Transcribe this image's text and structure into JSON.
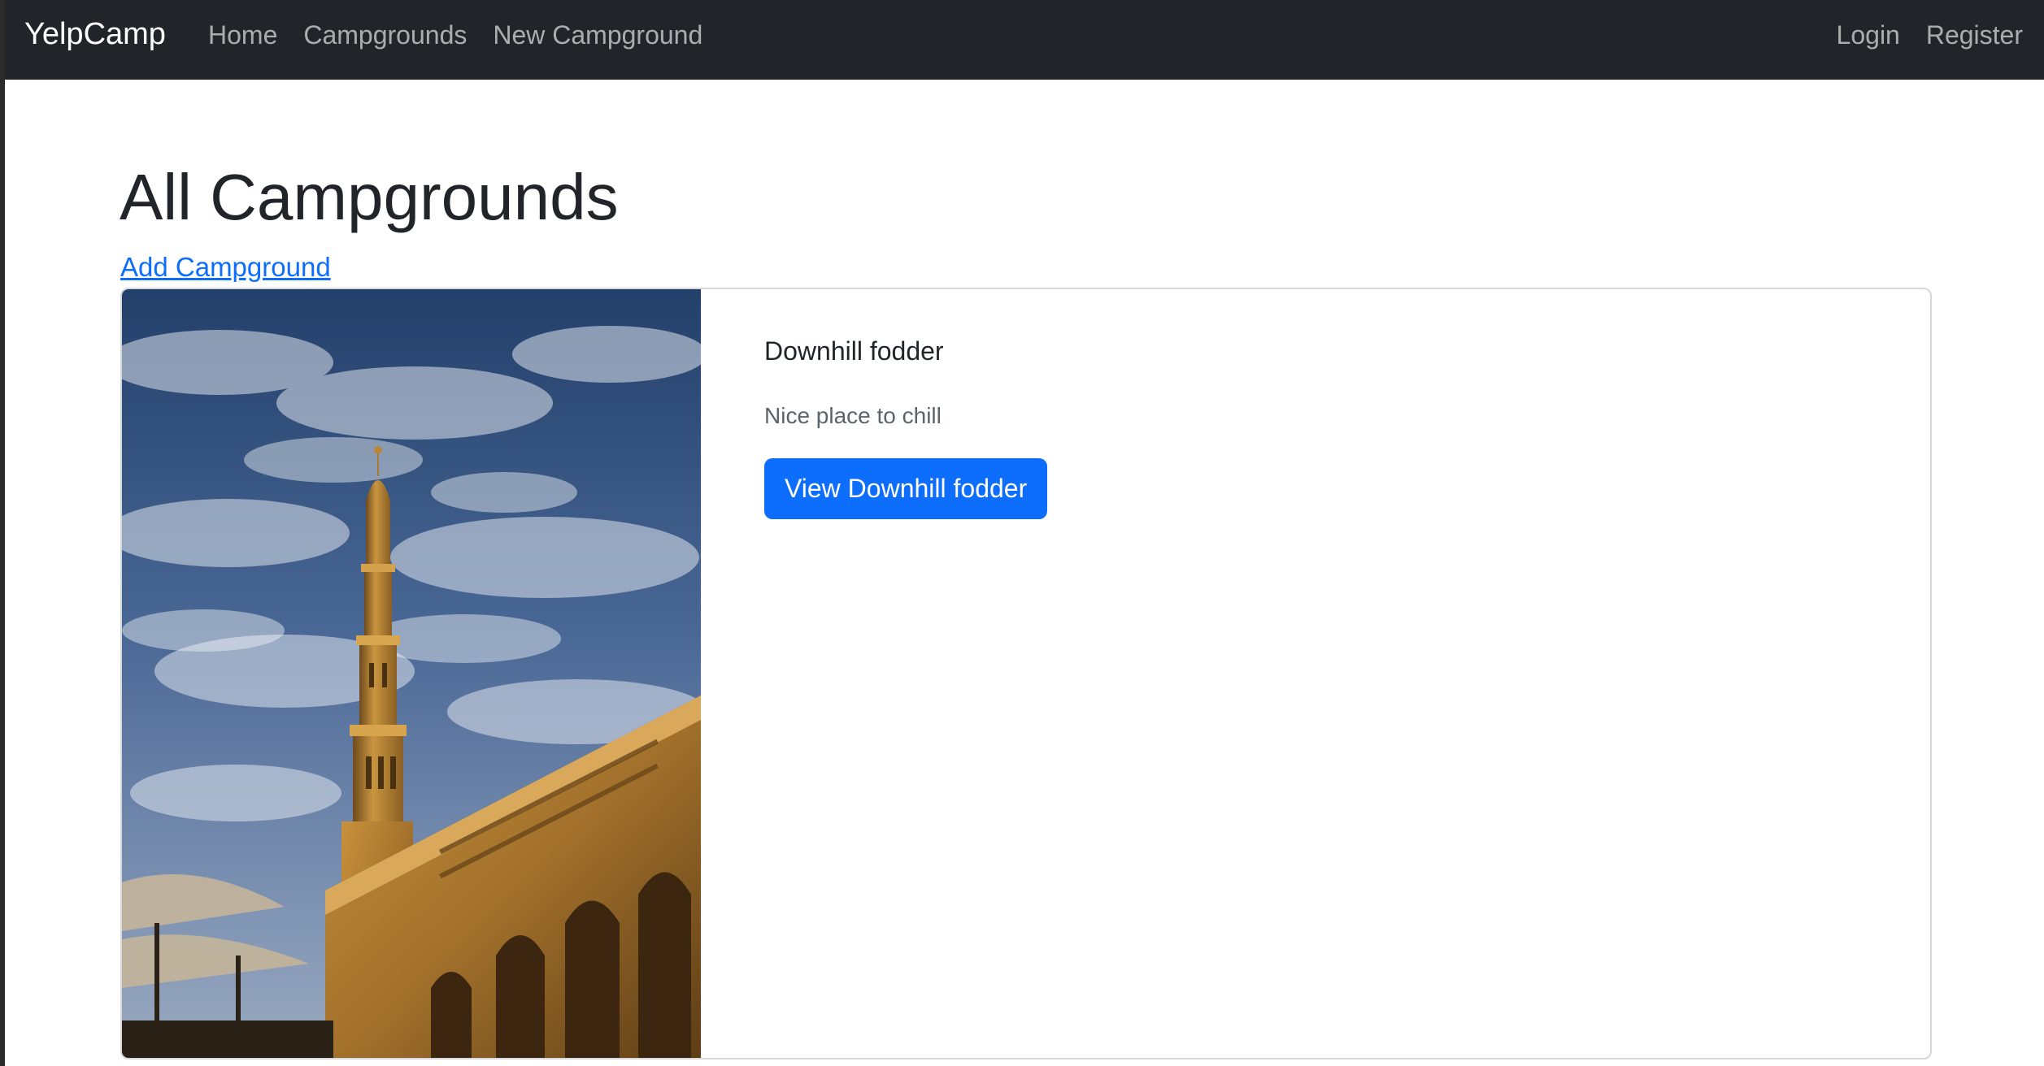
{
  "navbar": {
    "brand": "YelpCamp",
    "left_links": [
      "Home",
      "Campgrounds",
      "New Campground"
    ],
    "right_links": [
      "Login",
      "Register"
    ],
    "background": "#212529"
  },
  "main": {
    "title": "All Campgrounds",
    "add_link": "Add Campground"
  },
  "campgrounds": [
    {
      "title": "Downhill fodder",
      "description": "Nice place to chill",
      "button_label": "View Downhill fodder",
      "image": "mosque-minaret-photo"
    }
  ],
  "colors": {
    "accent": "#0d6efd",
    "link": "#0d6efd",
    "muted_text": "#5c636a"
  }
}
